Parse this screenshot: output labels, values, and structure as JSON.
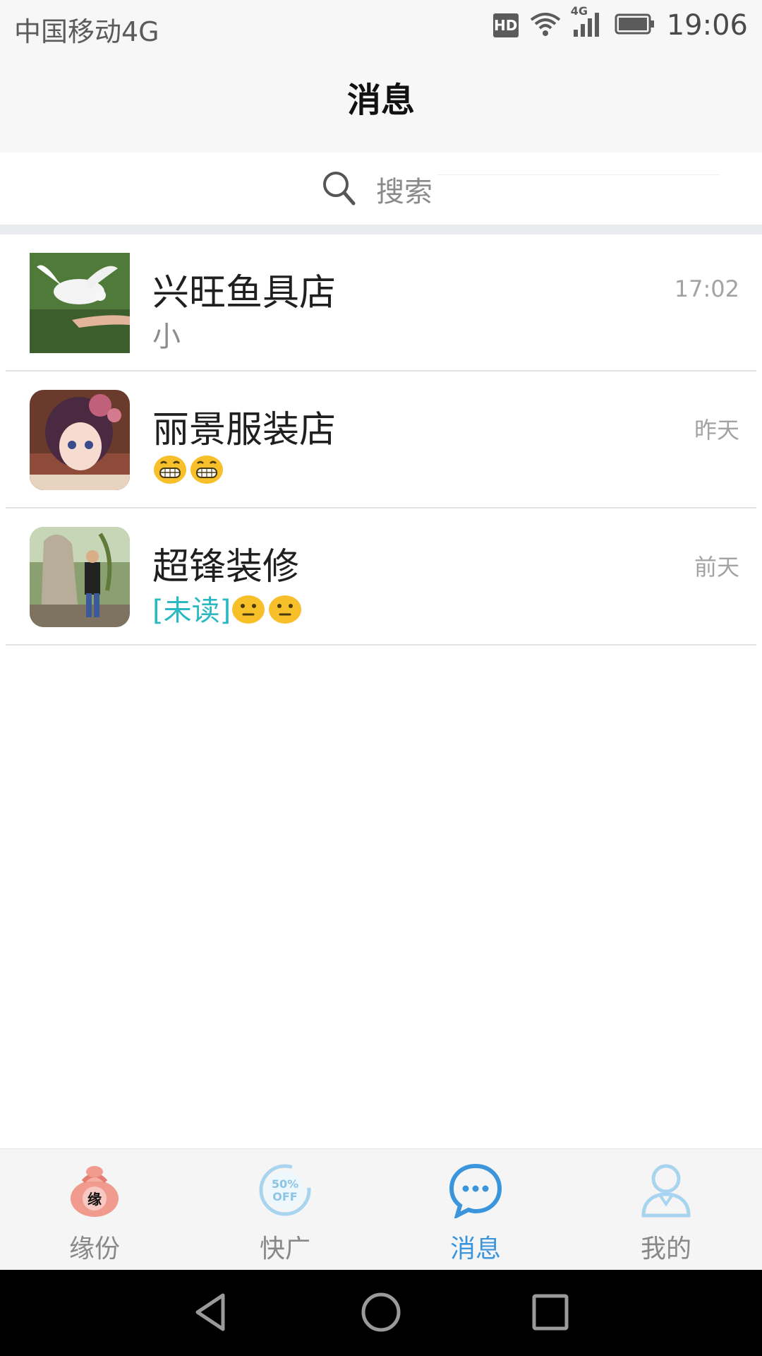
{
  "status_bar": {
    "carrier": "中国移动4G",
    "hd": "HD",
    "network": "4G",
    "time": "19:06"
  },
  "header": {
    "title": "消息"
  },
  "search": {
    "placeholder": "搜索"
  },
  "conversations": [
    {
      "name": "兴旺鱼具店",
      "preview": "小",
      "time": "17:02",
      "avatar": "white-dove-photo"
    },
    {
      "name": "丽景服装店",
      "preview_emojis": [
        "grin-emoji",
        "grin-emoji"
      ],
      "time": "昨天",
      "avatar": "anime-girl-photo"
    },
    {
      "name": "超锋装修",
      "unread_tag": "[未读]",
      "preview_emojis": [
        "neutral-emoji",
        "neutral-emoji"
      ],
      "time": "前天",
      "avatar": "man-by-rock-photo"
    }
  ],
  "bottom_nav": [
    {
      "label": "缘份",
      "icon": "lucky-bag-icon",
      "badge_text": "缘",
      "active": false
    },
    {
      "label": "快广",
      "icon": "discount-icon",
      "badge_text": "50% OFF",
      "active": false
    },
    {
      "label": "消息",
      "icon": "chat-bubble-icon",
      "active": true
    },
    {
      "label": "我的",
      "icon": "profile-icon",
      "active": false
    }
  ],
  "colors": {
    "accent": "#3a95dd",
    "unread": "#2cb8c2",
    "header_bg": "#f7f7f7"
  }
}
